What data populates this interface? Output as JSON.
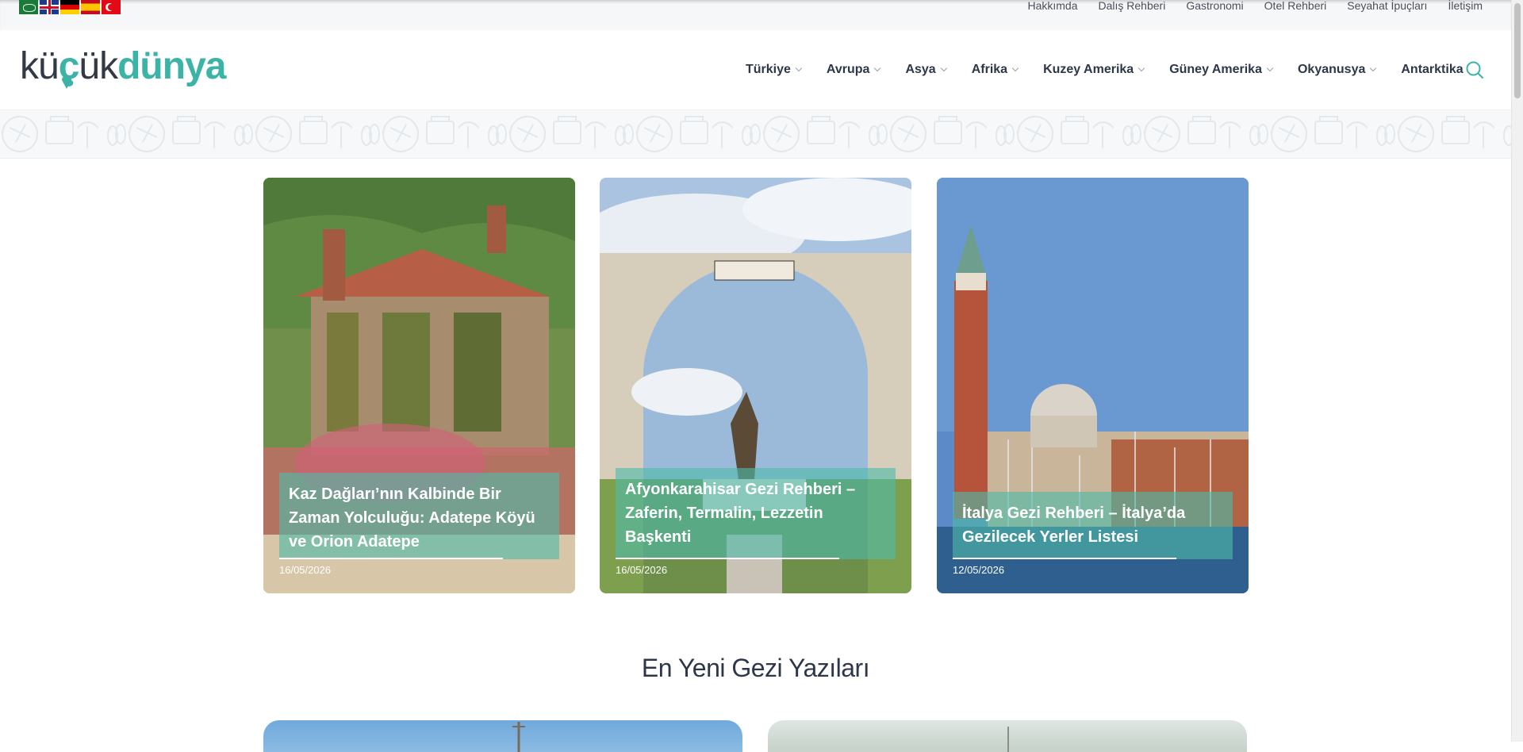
{
  "topbar": {
    "flags": [
      "Arabic",
      "English",
      "Deutsch",
      "Español",
      "Türkçe"
    ],
    "links": [
      "Hakkımda",
      "Dalış Rehberi",
      "Gastronomi",
      "Otel Rehberi",
      "Seyahat İpuçları",
      "İletişim"
    ]
  },
  "header": {
    "logo_part1": "kü",
    "logo_part2": "ç",
    "logo_part3": "ük",
    "logo_part4": "dünya",
    "nav": [
      {
        "label": "Türkiye",
        "has_dropdown": true
      },
      {
        "label": "Avrupa",
        "has_dropdown": true
      },
      {
        "label": "Asya",
        "has_dropdown": true
      },
      {
        "label": "Afrika",
        "has_dropdown": true
      },
      {
        "label": "Kuzey Amerika",
        "has_dropdown": true
      },
      {
        "label": "Güney Amerika",
        "has_dropdown": true
      },
      {
        "label": "Okyanusya",
        "has_dropdown": true
      },
      {
        "label": "Antarktika",
        "has_dropdown": false
      }
    ]
  },
  "featured": [
    {
      "title": "Kaz Dağları’nın Kalbinde Bir Zaman Yolculuğu: Adatepe Köyü ve Orion Adatepe",
      "date": "16/05/2026"
    },
    {
      "title": "Afyonkarahisar Gezi Rehberi – Zaferin, Termalin, Lezzetin Başkenti",
      "date": "16/05/2026"
    },
    {
      "title": "İtalya Gezi Rehberi – İtalya’da Gezilecek Yerler Listesi",
      "date": "12/05/2026"
    }
  ],
  "section": {
    "title": "En Yeni Gezi Yazıları"
  },
  "colors": {
    "accent": "#3bb3a7",
    "caption": "#4fb9aa",
    "text": "#2d3748"
  }
}
